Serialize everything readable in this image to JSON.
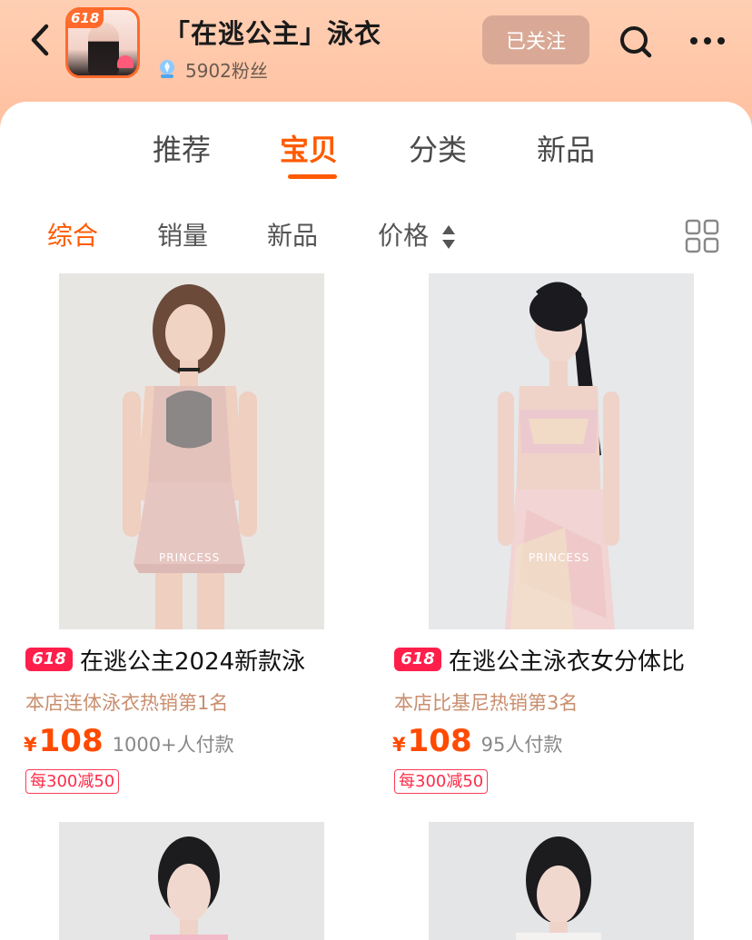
{
  "header": {
    "store_name": "「在逃公主」泳衣",
    "fans": "5902粉丝",
    "follow_label": "已关注",
    "avatar_badge": "618"
  },
  "tabs": [
    {
      "label": "推荐",
      "active": false
    },
    {
      "label": "宝贝",
      "active": true
    },
    {
      "label": "分类",
      "active": false
    },
    {
      "label": "新品",
      "active": false
    }
  ],
  "sort": [
    {
      "label": "综合",
      "active": true
    },
    {
      "label": "销量",
      "active": false
    },
    {
      "label": "新品",
      "active": false
    },
    {
      "label": "价格",
      "active": false
    }
  ],
  "products": [
    {
      "tag": "618",
      "title": "在逃公主2024新款泳",
      "rank": "本店连体泳衣热销第1名",
      "currency": "¥",
      "price": "108",
      "sold": "1000+人付款",
      "promo": "每300减50",
      "watermark": "PRINCESS"
    },
    {
      "tag": "618",
      "title": "在逃公主泳衣女分体比",
      "rank": "本店比基尼热销第3名",
      "currency": "¥",
      "price": "108",
      "sold": "95人付款",
      "promo": "每300减50",
      "watermark": "PRINCESS"
    }
  ],
  "colors": {
    "accent": "#ff5a00",
    "header_bg": "#ffc6a8",
    "follow_bg": "#d9a996",
    "price": "#ff4a00",
    "tag_red": "#ff1f4a",
    "rank_text": "#c98e6e"
  },
  "icons": [
    "back-icon",
    "search-icon",
    "more-icon",
    "fans-level-icon",
    "sort-arrows-icon",
    "grid-view-icon"
  ]
}
